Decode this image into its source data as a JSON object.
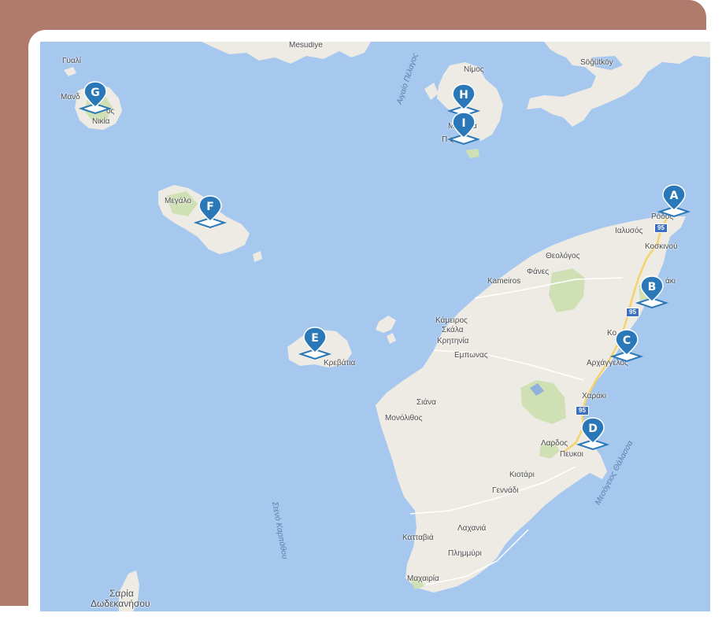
{
  "colors": {
    "frame_accent": "#b07a6c",
    "water": "#a6c7ee",
    "land": "#eeebe4",
    "park": "#cfe0b5",
    "road": "#f5d36a",
    "marker": "#2a78b8"
  },
  "map": {
    "markers": [
      {
        "letter": "A"
      },
      {
        "letter": "B"
      },
      {
        "letter": "C"
      },
      {
        "letter": "D"
      },
      {
        "letter": "E"
      },
      {
        "letter": "F"
      },
      {
        "letter": "G"
      },
      {
        "letter": "H"
      },
      {
        "letter": "I"
      }
    ],
    "places": {
      "mesudiye": "Mesudiye",
      "sogutkoy": "Söğütköy",
      "gyali": "Γυαλί",
      "mandraki": "Μανδ",
      "nikia": "Νικία",
      "nisyros_partial": "ος",
      "nimos": "Νίμος",
      "mesounta": "Μ   ούντα",
      "pigadia": "Π      ς",
      "aegean": "Αιγαίο Πέλαγος",
      "megalo": "Μεγάλο",
      "rodos": "Ρόδος",
      "ialysos": "Ιαλυσός",
      "koskinou": "Κοσκινού",
      "theologos": "Θεολόγος",
      "fanes": "Φάνες",
      "kameiros": "Kameiros",
      "afandou": "άκι",
      "kamiros_skala_1": "Κάμειρος",
      "kamiros_skala_2": "Σκάλα",
      "kritinia": "Κρητηνία",
      "kolymbia": "Κο",
      "archangelos": "Αρχάγγελος",
      "empona": "Εμπωνας",
      "kremasti_island": "Κρεβάτια",
      "charaki": "Χαράκι",
      "siana": "Σιάνα",
      "monolithos": "Μονόλιθος",
      "lardos": "Λαρδος",
      "pefkoi": "Πευκοι",
      "kiotari": "Κιοτάρι",
      "gennadi": "Γεννάδι",
      "mediterranean": "Μεσόγειος Θάλασσα",
      "karpathos_strait": "Στενό Καρπάθου",
      "lachania": "Λαχανιά",
      "kattavia": "Κατταβιά",
      "plimmyri": "Πλημμύρι",
      "machairia": "Μαχαιρία",
      "saria_1": "Σαρία",
      "saria_2": "Δωδεκανήσου"
    },
    "road_number": "95"
  }
}
